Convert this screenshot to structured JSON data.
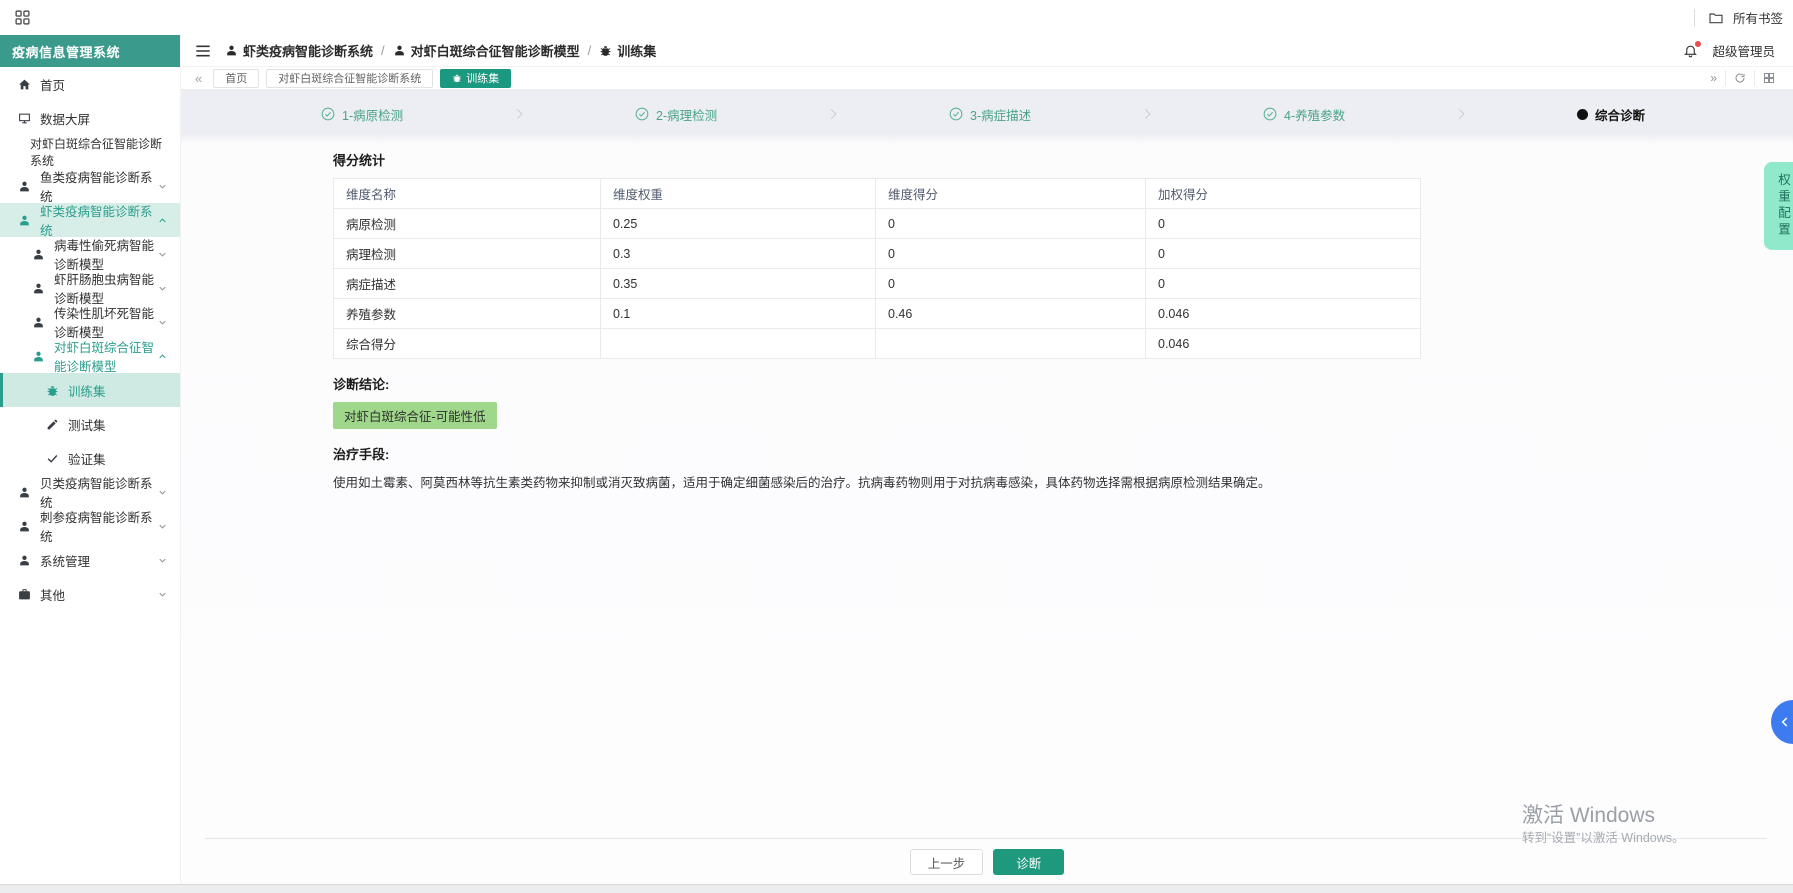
{
  "browser": {
    "bookmarks_label": "所有书签"
  },
  "sidebar": {
    "title": "疫病信息管理系统",
    "items": [
      {
        "label": "首页"
      },
      {
        "label": "数据大屏"
      },
      {
        "label": "对虾白斑综合征智能诊断系统"
      },
      {
        "label": "鱼类疫病智能诊断系统"
      },
      {
        "label": "虾类疫病智能诊断系统"
      },
      {
        "label": "病毒性偷死病智能诊断模型"
      },
      {
        "label": "虾肝肠胞虫病智能诊断模型"
      },
      {
        "label": "传染性肌坏死智能诊断模型"
      },
      {
        "label": "对虾白斑综合征智能诊断模型"
      },
      {
        "label": "训练集"
      },
      {
        "label": "测试集"
      },
      {
        "label": "验证集"
      },
      {
        "label": "贝类疫病智能诊断系统"
      },
      {
        "label": "刺参疫病智能诊断系统"
      },
      {
        "label": "系统管理"
      },
      {
        "label": "其他"
      }
    ]
  },
  "topbar": {
    "breadcrumb": [
      "虾类疫病智能诊断系统",
      "对虾白斑综合征智能诊断模型",
      "训练集"
    ],
    "user": "超级管理员"
  },
  "tabbar": {
    "tabs": [
      "首页",
      "对虾白斑综合征智能诊断系统",
      "训练集"
    ],
    "active_tab": "训练集"
  },
  "stepper": {
    "steps": [
      {
        "label": "1-病原检测",
        "state": "done"
      },
      {
        "label": "2-病理检测",
        "state": "done"
      },
      {
        "label": "3-病症描述",
        "state": "done"
      },
      {
        "label": "4-养殖参数",
        "state": "done"
      },
      {
        "label": "综合诊断",
        "state": "current"
      }
    ]
  },
  "main": {
    "score_title": "得分统计",
    "table": {
      "headers": [
        "维度名称",
        "维度权重",
        "维度得分",
        "加权得分"
      ],
      "rows": [
        [
          "病原检测",
          "0.25",
          "0",
          "0"
        ],
        [
          "病理检测",
          "0.3",
          "0",
          "0"
        ],
        [
          "病症描述",
          "0.35",
          "0",
          "0"
        ],
        [
          "养殖参数",
          "0.1",
          "0.46",
          "0.046"
        ],
        [
          "综合得分",
          "",
          "",
          "0.046"
        ]
      ]
    },
    "conclusion_label": "诊断结论:",
    "conclusion_badge": "对虾白斑综合征-可能性低",
    "treatment_label": "治疗手段:",
    "treatment_text": "使用如土霉素、阿莫西林等抗生素类药物来抑制或消灭致病菌，适用于确定细菌感染后的治疗。抗病毒药物则用于对抗病毒感染，具体药物选择需根据病原检测结果确定。",
    "prev_button": "上一步",
    "diagnose_button": "诊断"
  },
  "right_rail": {
    "weight_config": "权重配置"
  },
  "watermark": {
    "line1": "激活 Windows",
    "line2": "转到“设置”以激活 Windows。"
  },
  "colors": {
    "brand_teal": "#3a9a8b",
    "accent_teal": "#2a9d8c",
    "tab_active": "#1b9880",
    "button_primary": "#1f997e",
    "step_done": "#47a385",
    "badge_green": "#9fd88b",
    "weight_badge_mint": "#8fe9ca",
    "back_circle_blue": "#3c7cf0",
    "notification_red": "#e94f4f"
  }
}
